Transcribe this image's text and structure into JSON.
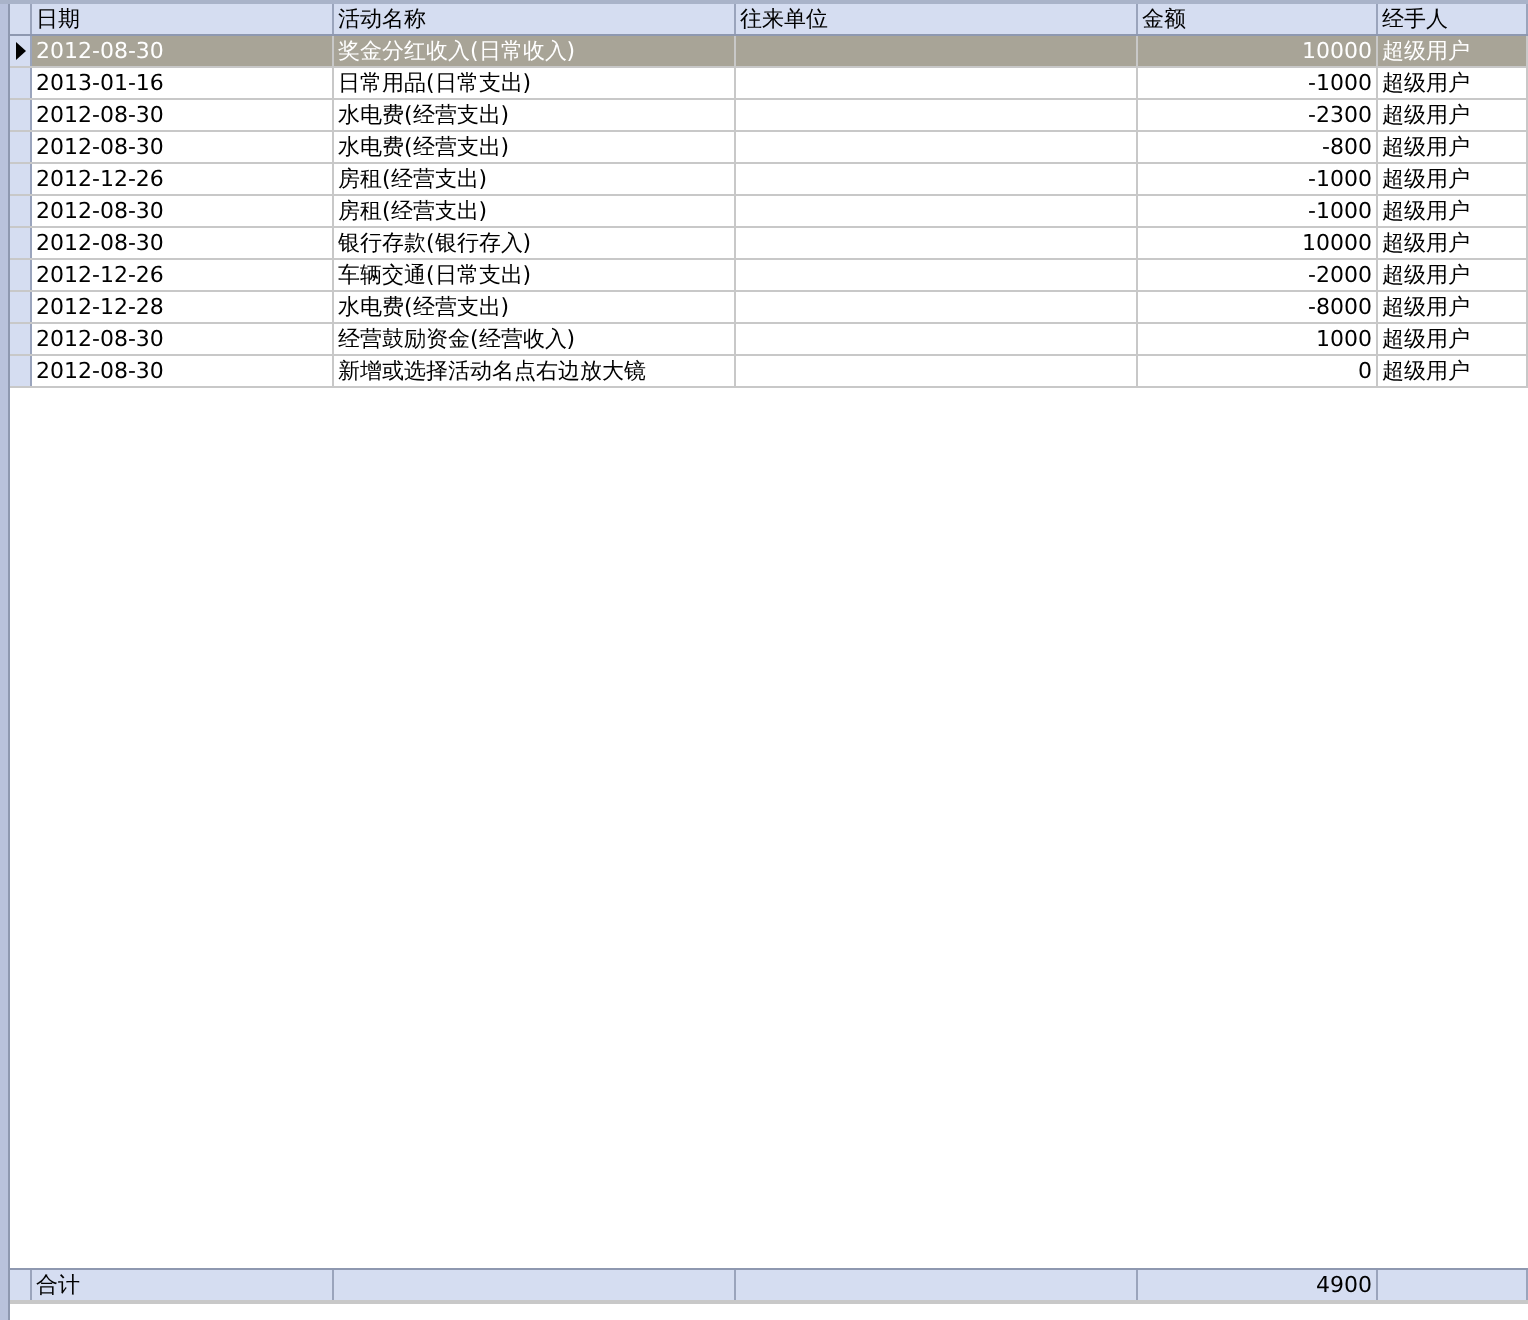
{
  "table": {
    "columns": [
      "日期",
      "活动名称",
      "往来单位",
      "金额",
      "经手人"
    ],
    "rows": [
      {
        "date": "2012-08-30",
        "activity": "奖金分红收入(日常收入)",
        "amount": "10000",
        "handler": "超级用户",
        "selected": true
      },
      {
        "date": "2013-01-16",
        "activity": "日常用品(日常支出)",
        "amount": "-1000",
        "handler": "超级用户",
        "selected": false
      },
      {
        "date": "2012-08-30",
        "activity": "水电费(经营支出)",
        "amount": "-2300",
        "handler": "超级用户",
        "selected": false
      },
      {
        "date": "2012-08-30",
        "activity": "水电费(经营支出)",
        "amount": "-800",
        "handler": "超级用户",
        "selected": false
      },
      {
        "date": "2012-12-26",
        "activity": "房租(经营支出)",
        "amount": "-1000",
        "handler": "超级用户",
        "selected": false
      },
      {
        "date": "2012-08-30",
        "activity": "房租(经营支出)",
        "amount": "-1000",
        "handler": "超级用户",
        "selected": false
      },
      {
        "date": "2012-08-30",
        "activity": "银行存款(银行存入)",
        "amount": "10000",
        "handler": "超级用户",
        "selected": false
      },
      {
        "date": "2012-12-26",
        "activity": "车辆交通(日常支出)",
        "amount": "-2000",
        "handler": "超级用户",
        "selected": false
      },
      {
        "date": "2012-12-28",
        "activity": "水电费(经营支出)",
        "amount": "-8000",
        "handler": "超级用户",
        "selected": false
      },
      {
        "date": "2012-08-30",
        "activity": "经营鼓励资金(经营收入)",
        "amount": "1000",
        "handler": "超级用户",
        "selected": false
      },
      {
        "date": "2012-08-30",
        "activity": "新增或选择活动名点右边放大镜",
        "amount": "0",
        "handler": "超级用户",
        "selected": false
      }
    ],
    "footer": {
      "label": "合计",
      "amount": "4900"
    }
  }
}
